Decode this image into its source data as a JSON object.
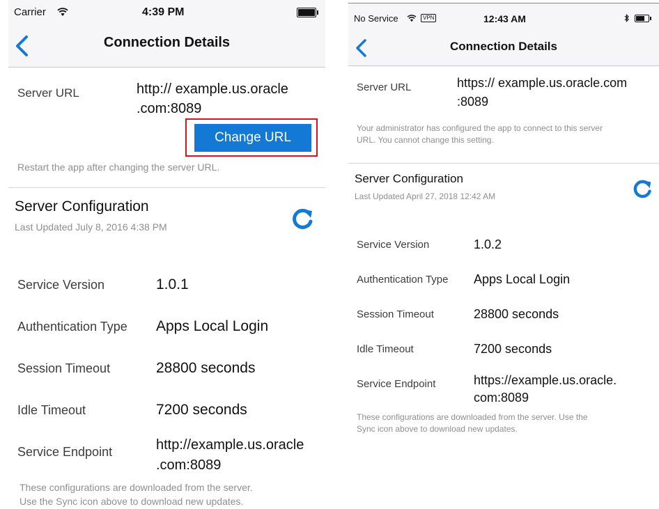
{
  "left": {
    "status": {
      "carrier": "Carrier",
      "time": "4:39 PM"
    },
    "nav": {
      "title": "Connection Details"
    },
    "server_url": {
      "label": "Server URL",
      "value_line1": "http:// example.us.oracle",
      "value_line2": ".com:8089",
      "button": "Change URL",
      "note": "Restart the app after changing the server URL."
    },
    "config": {
      "title": "Server Configuration",
      "updated": "Last Updated July 8, 2016 4:38 PM",
      "rows": [
        {
          "label": "Service Version",
          "value": "1.0.1"
        },
        {
          "label": "Authentication Type",
          "value": "Apps Local Login"
        },
        {
          "label": "Session Timeout",
          "value": "28800 seconds"
        },
        {
          "label": "Idle Timeout",
          "value": "7200 seconds"
        },
        {
          "label": "Service Endpoint",
          "value_line1": "http://example.us.oracle",
          "value_line2": ".com:8089"
        }
      ],
      "note_line1": "These configurations are downloaded from the server.",
      "note_line2": "Use the Sync icon above to download new updates."
    }
  },
  "right": {
    "status": {
      "carrier": "No Service",
      "vpn": "VPN",
      "time": "12:43 AM"
    },
    "nav": {
      "title": "Connection Details"
    },
    "server_url": {
      "label": "Server URL",
      "value_line1": "https:// example.us.oracle.com",
      "value_line2": ":8089",
      "note_line1": "Your administrator has configured the app to connect to this server",
      "note_line2": "URL. You cannot change this setting."
    },
    "config": {
      "title": "Server Configuration",
      "updated": "Last Updated April 27, 2018 12:42 AM",
      "rows": [
        {
          "label": "Service Version",
          "value": "1.0.2"
        },
        {
          "label": "Authentication Type",
          "value": "Apps Local Login"
        },
        {
          "label": "Session Timeout",
          "value": "28800 seconds"
        },
        {
          "label": "Idle Timeout",
          "value": "7200 seconds"
        },
        {
          "label": "Service Endpoint",
          "value_line1": "https://example.us.oracle.",
          "value_line2": "com:8089"
        }
      ],
      "note_line1": "These configurations are downloaded from the server. Use the",
      "note_line2": "Sync icon above to download new updates."
    }
  },
  "icons": {
    "back": "chevron-left-icon",
    "sync": "refresh-icon",
    "wifi": "wifi-icon",
    "battery": "battery-icon",
    "bluetooth": "bluetooth-icon"
  },
  "colors": {
    "accent": "#1479d4",
    "highlight": "#d9121f",
    "note": "#8e8e93"
  }
}
